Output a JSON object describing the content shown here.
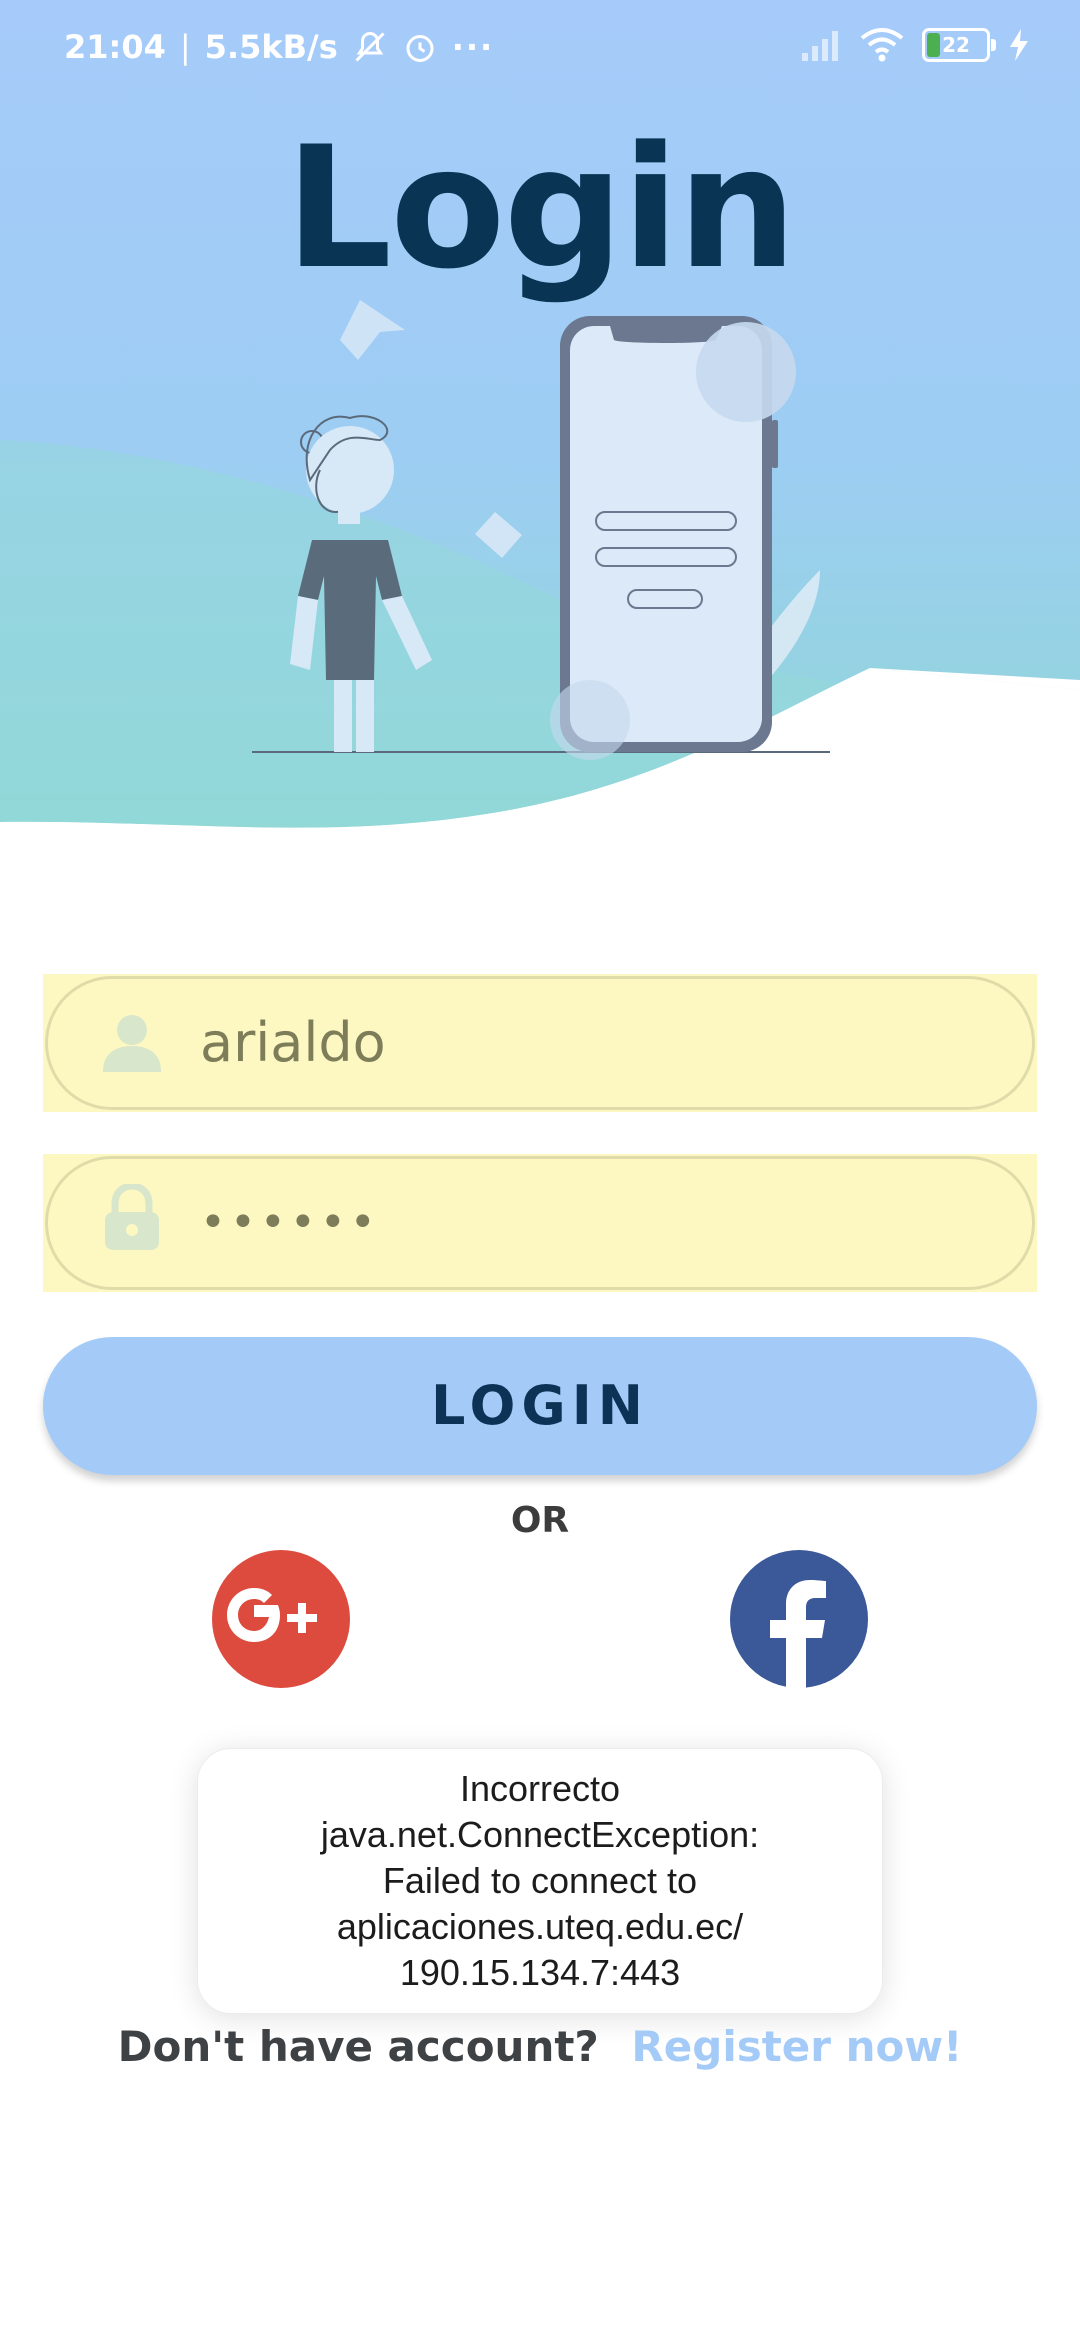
{
  "status_bar": {
    "time": "21:04",
    "speed": "5.5kB/s",
    "battery_level": "22",
    "icons": [
      "mute-icon",
      "alarm-icon",
      "more-icon",
      "signal-icon",
      "wifi-icon",
      "battery-icon",
      "charging-icon"
    ]
  },
  "header": {
    "title": "Login",
    "gradient_top": "#a6cbfa",
    "gradient_bottom": "#93d6d9"
  },
  "form": {
    "username": {
      "value": "arialdo",
      "icon": "user-icon"
    },
    "password": {
      "value": "••••••",
      "icon": "lock-icon"
    },
    "field_bg": "#fdf8c2"
  },
  "login_button": {
    "label": "LOGIN",
    "color": "#a4cbf8"
  },
  "or_label": "OR",
  "social": {
    "google_icon": "google-plus-icon",
    "google_color": "#dd4b3f",
    "facebook_icon": "facebook-icon",
    "facebook_color": "#3b5898"
  },
  "toast": {
    "lines": [
      "Incorrecto",
      "java.net.ConnectException:",
      "Failed to connect to",
      "aplicaciones.uteq.edu.ec/",
      "190.15.134.7:443"
    ]
  },
  "register": {
    "prompt": "Don't have account?",
    "link": "Register now!"
  }
}
